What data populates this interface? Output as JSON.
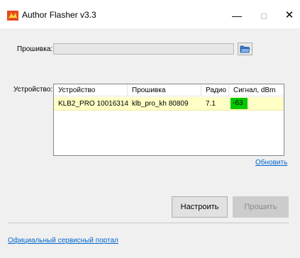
{
  "window": {
    "title": "Author Flasher v3.3",
    "minimize_glyph": "—",
    "close_glyph": "✕"
  },
  "firmware": {
    "label": "Прошивка:",
    "path_value": "",
    "folder_icon": "folder-open-icon"
  },
  "device": {
    "label": "Устройство:",
    "columns": [
      "Устройство",
      "Прошивка",
      "Радио",
      "Сигнал, dBm"
    ],
    "rows": [
      {
        "device": "KLB2_PRO  10016314",
        "firmware": "klb_pro_kh 80809",
        "radio": "7.1",
        "signal": "-63"
      }
    ],
    "signal_color": "#00c800",
    "row_highlight_color": "#ffffc6",
    "refresh_label": "Обновить"
  },
  "actions": {
    "configure_label": "Настроить",
    "flash_label": "Прошить"
  },
  "footer": {
    "portal_link": "Официальный сервисный портал"
  },
  "colors": {
    "link": "#0066cc",
    "app_icon": "#e8491d"
  }
}
